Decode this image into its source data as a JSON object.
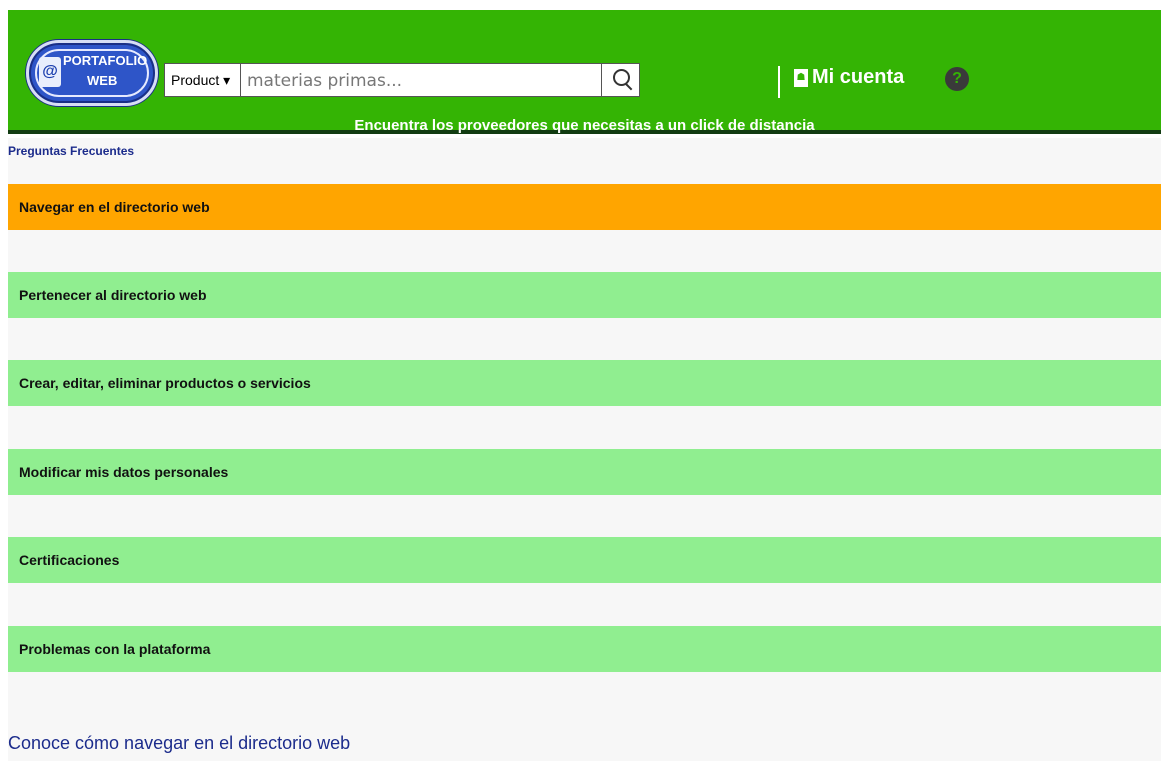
{
  "logo": {
    "line1": "PORTAFOLIO",
    "line2": "WEB",
    "mark": "@"
  },
  "search": {
    "category": "Product ▾",
    "placeholder": "materias primas...",
    "icon": "search-icon"
  },
  "header": {
    "tagline": "Encuentra los proveedores que necesitas a un click de distancia",
    "account_label": "Mi cuenta",
    "help_label": "?"
  },
  "faq": {
    "link": "Preguntas Frecuentes",
    "items": [
      {
        "label": "Navegar en el directorio web",
        "active": true
      },
      {
        "label": "Pertenecer al directorio web"
      },
      {
        "label": "Crear, editar, eliminar productos o servicios"
      },
      {
        "label": "Modificar mis datos personales"
      },
      {
        "label": "Certificaciones"
      },
      {
        "label": "Problemas con la plataforma"
      }
    ],
    "section_title": "Conoce cómo navegar en el directorio web"
  },
  "colors": {
    "header": "#34b404",
    "active": "#ffa500",
    "item": "#90ee90",
    "link": "#1c2c8c"
  }
}
